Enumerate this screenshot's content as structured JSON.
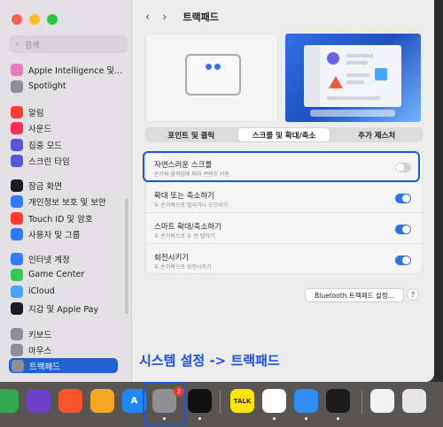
{
  "window": {
    "title": "트랙패드"
  },
  "colors": {
    "accent": "#2e73e6",
    "highlight": "#1f55d8",
    "close": "#fe5f57",
    "minimize": "#febc2e",
    "zoom": "#28c840"
  },
  "sidebar": {
    "search_placeholder": "검색",
    "items": [
      {
        "label": "Apple Intelligence 및...",
        "icon": "apple-intelligence-icon",
        "color": "#e87ac0"
      },
      {
        "label": "Spotlight",
        "icon": "spotlight-icon",
        "color": "#8e8e93"
      },
      {
        "label": "알림",
        "icon": "bell-icon",
        "color": "#ff3b30"
      },
      {
        "label": "사운드",
        "icon": "speaker-icon",
        "color": "#ff2d55"
      },
      {
        "label": "집중 모드",
        "icon": "moon-icon",
        "color": "#5856d6"
      },
      {
        "label": "스크린 타임",
        "icon": "hourglass-icon",
        "color": "#5856d6"
      },
      {
        "label": "잠금 화면",
        "icon": "lock-icon",
        "color": "#1c1c1e"
      },
      {
        "label": "개인정보 보호 및 보안",
        "icon": "hand-icon",
        "color": "#2f7cf6"
      },
      {
        "label": "Touch ID 및 암호",
        "icon": "fingerprint-icon",
        "color": "#ff3b30"
      },
      {
        "label": "사용자 및 그룹",
        "icon": "users-icon",
        "color": "#2f7cf6"
      },
      {
        "label": "인터넷 계정",
        "icon": "at-icon",
        "color": "#2f7cf6"
      },
      {
        "label": "Game Center",
        "icon": "game-center-icon",
        "color": "#34c759"
      },
      {
        "label": "iCloud",
        "icon": "cloud-icon",
        "color": "#4aa3f5"
      },
      {
        "label": "지갑 및 Apple Pay",
        "icon": "wallet-icon",
        "color": "#1c1c1e"
      },
      {
        "label": "키보드",
        "icon": "keyboard-icon",
        "color": "#8e8e93"
      },
      {
        "label": "마우스",
        "icon": "mouse-icon",
        "color": "#8e8e93"
      },
      {
        "label": "트랙패드",
        "icon": "trackpad-icon",
        "color": "#8e8e93",
        "selected": true
      }
    ]
  },
  "tabs": [
    "포인트 및 클릭",
    "스크롤 및 확대/축소",
    "추가 제스처"
  ],
  "active_tab": 1,
  "settings": [
    {
      "label": "자연스러운 스크롤",
      "sub": "손가락 움직임에 따라 콘텐츠 이동",
      "on": false
    },
    {
      "label": "확대 또는 축소하기",
      "sub": "두 손가락으로 벌리거나 오므리기",
      "on": true
    },
    {
      "label": "스마트 확대/축소하기",
      "sub": "두 손가락으로 두 번 탭하기",
      "on": true
    },
    {
      "label": "회전시키기",
      "sub": "두 손가락으로 회전시키기",
      "on": true
    }
  ],
  "bluetooth_button": "Bluetooth 트랙패드 설정...",
  "help_label": "?",
  "caption": "시스템 설정 -> 트랙패드",
  "dock": {
    "settings_badge": "2",
    "items": [
      {
        "name": "numbers-icon",
        "color": "#2fa84f",
        "glyph": ""
      },
      {
        "name": "github-icon",
        "color": "#6e40c9",
        "glyph": ""
      },
      {
        "name": "brave-icon",
        "color": "#fb542b",
        "glyph": ""
      },
      {
        "name": "pages-icon",
        "color": "#f6a623",
        "glyph": ""
      },
      {
        "name": "app-store-icon",
        "color": "#1e88f5",
        "glyph": "A"
      },
      {
        "name": "system-settings-icon",
        "color": "#8e8e93",
        "glyph": ""
      },
      {
        "name": "capcut-icon",
        "color": "#111111",
        "glyph": ""
      },
      {
        "name": "kakaotalk-icon",
        "color": "#fee500",
        "glyph": "TALK"
      },
      {
        "name": "chrome-icon",
        "color": "#ffffff",
        "glyph": ""
      },
      {
        "name": "mail-icon",
        "color": "#2f8df5",
        "glyph": ""
      },
      {
        "name": "stocks-icon",
        "color": "#1c1c1e",
        "glyph": ""
      },
      {
        "name": "preview-icon",
        "color": "#f2f2f2",
        "glyph": ""
      },
      {
        "name": "keyboard-viewer-icon",
        "color": "#e5e5e5",
        "glyph": ""
      }
    ]
  }
}
